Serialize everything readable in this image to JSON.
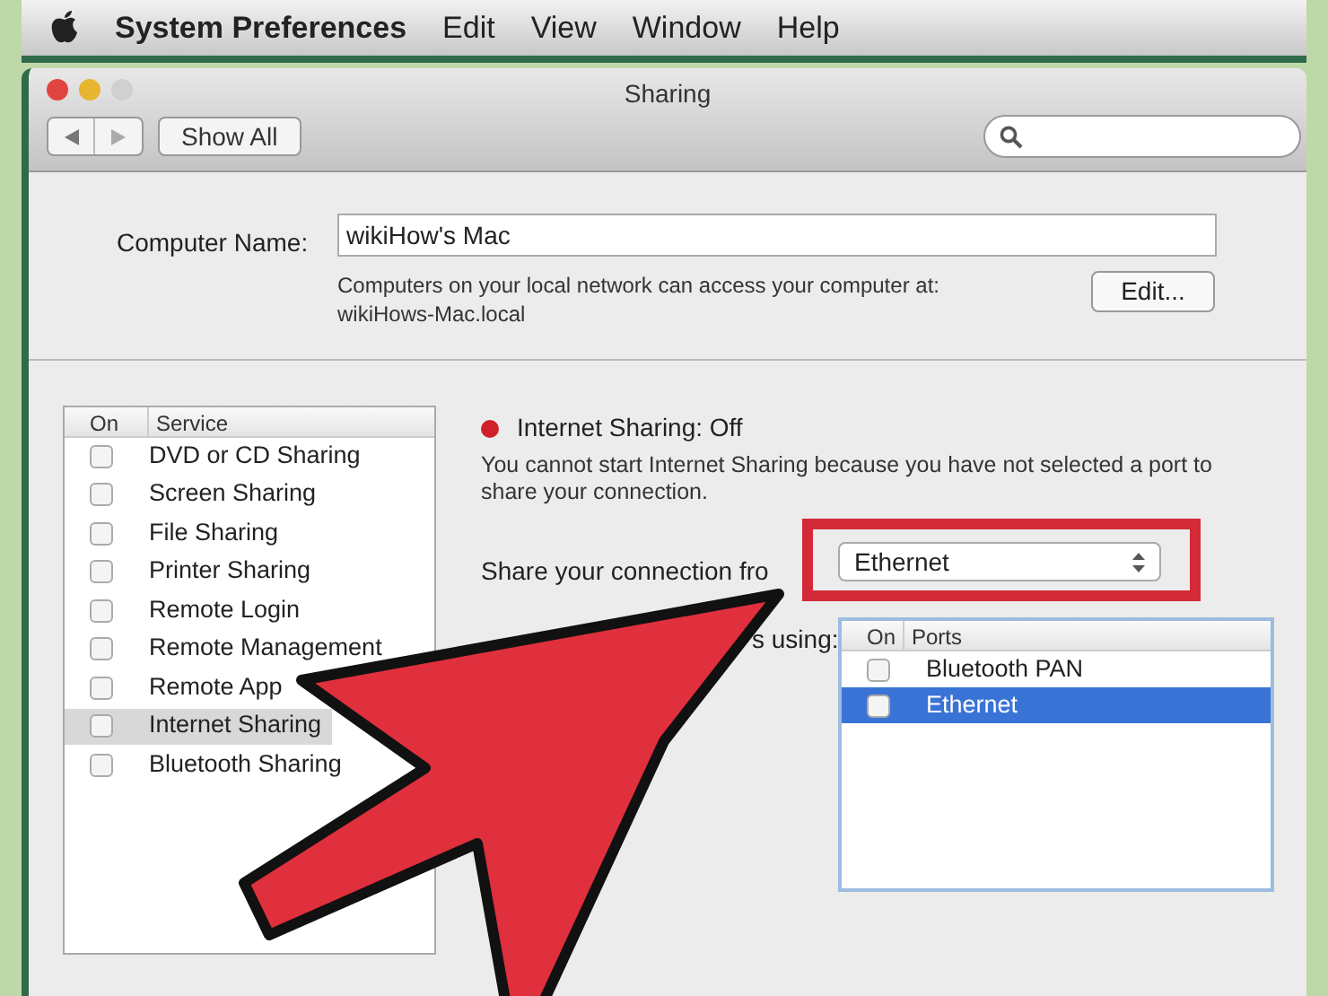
{
  "menu_bar": {
    "app": "System Preferences",
    "items": [
      "Edit",
      "View",
      "Window",
      "Help"
    ]
  },
  "window": {
    "title": "Sharing"
  },
  "toolbar": {
    "show_all": "Show All"
  },
  "computer_name": {
    "label": "Computer Name:",
    "value": "wikiHow's Mac",
    "note": "Computers on your local network can access your computer at:",
    "address": "wikiHows-Mac.local",
    "edit_button": "Edit..."
  },
  "services": {
    "columns": [
      "On",
      "Service"
    ],
    "rows": [
      {
        "name": "DVD or CD Sharing",
        "checked": false,
        "selected": false
      },
      {
        "name": "Screen Sharing",
        "checked": false,
        "selected": false
      },
      {
        "name": "File Sharing",
        "checked": false,
        "selected": false
      },
      {
        "name": "Printer Sharing",
        "checked": false,
        "selected": false
      },
      {
        "name": "Remote Login",
        "checked": false,
        "selected": false
      },
      {
        "name": "Remote Management",
        "checked": false,
        "selected": false
      },
      {
        "name": "Remote App",
        "checked": false,
        "selected": false
      },
      {
        "name": "Internet Sharing",
        "checked": false,
        "selected": true
      },
      {
        "name": "Bluetooth Sharing",
        "checked": false,
        "selected": false
      }
    ]
  },
  "detail": {
    "status": "Internet Sharing: Off",
    "on": false,
    "message": "You cannot start Internet Sharing because you have not selected a port to share your connection.",
    "share_from_label": "Share your connection fro",
    "share_from_value": "Ethernet",
    "to_label": "s using:",
    "ports": {
      "columns": [
        "On",
        "Ports"
      ],
      "rows": [
        {
          "name": "Bluetooth PAN",
          "checked": false,
          "selected": false
        },
        {
          "name": "Ethernet",
          "checked": false,
          "selected": true
        }
      ]
    }
  }
}
